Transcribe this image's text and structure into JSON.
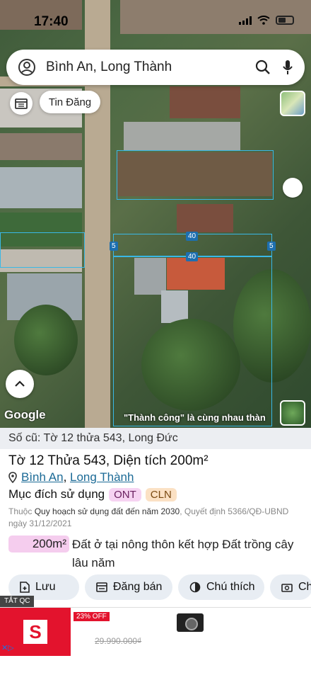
{
  "status": {
    "time": "17:40"
  },
  "search": {
    "query": "Bình An, Long Thành"
  },
  "map": {
    "tab_label": "Tin Đăng",
    "parcel_labels": [
      "40",
      "40",
      "5",
      "5"
    ],
    "google_label": "Google",
    "banner": "\"Thành công\" là cùng nhau thàn"
  },
  "panel": {
    "old_number": "Số cũ: Tờ 12 thửa 543, Long Đức",
    "title_prefix": "Tờ 12 Thửa 543, ",
    "title_area": "Diện tích 200m²",
    "location_ward": "Bình An",
    "location_sep": ", ",
    "location_district": "Long Thành",
    "purpose_label": "Mục đích sử dụng",
    "tags": [
      "ONT",
      "CLN"
    ],
    "plan_prefix": "Thuộc ",
    "plan_name": "Quy hoạch sử dụng đất đến năm 2030",
    "plan_suffix": ", Quyết định 5366/QĐ-UBND ngày 31/12/2021",
    "area_value": "200m²",
    "area_desc": "Đất ở tại nông thôn kết hợp Đất trồng cây lâu năm",
    "actions": [
      "Lưu",
      "Đăng bán",
      "Chú thích",
      "Ch"
    ]
  },
  "ad": {
    "label": "TẮT QC",
    "discount": "23% OFF",
    "old_price": "29.990.000₫",
    "logo_letter": "S"
  }
}
